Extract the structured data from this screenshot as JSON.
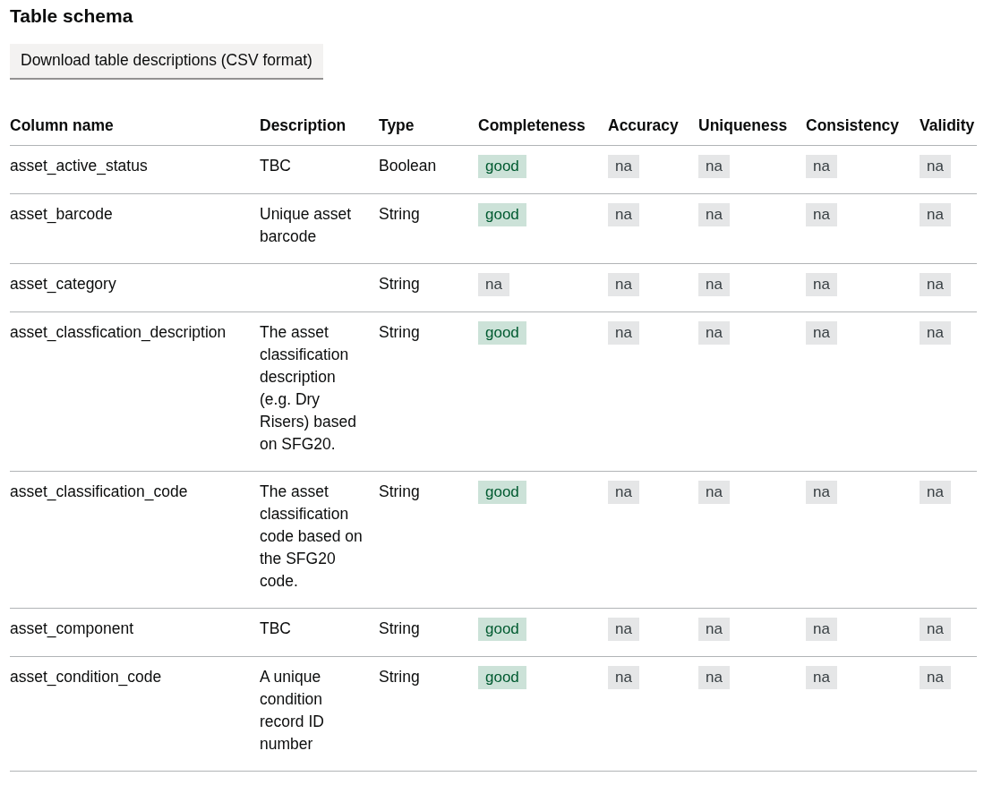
{
  "title": "Table schema",
  "download_button": "Download table descriptions (CSV format)",
  "table": {
    "columns": [
      "Column name",
      "Description",
      "Type",
      "Completeness",
      "Accuracy",
      "Uniqueness",
      "Consistency",
      "Validity"
    ],
    "rows": [
      {
        "name": "asset_active_status",
        "description": "TBC",
        "type": "Boolean",
        "tags": [
          {
            "label": "good",
            "kind": "positive"
          },
          {
            "label": "na",
            "kind": "neutral"
          },
          {
            "label": "na",
            "kind": "neutral"
          },
          {
            "label": "na",
            "kind": "neutral"
          },
          {
            "label": "na",
            "kind": "neutral"
          }
        ]
      },
      {
        "name": "asset_barcode",
        "description": "Unique asset barcode",
        "type": "String",
        "tags": [
          {
            "label": "good",
            "kind": "positive"
          },
          {
            "label": "na",
            "kind": "neutral"
          },
          {
            "label": "na",
            "kind": "neutral"
          },
          {
            "label": "na",
            "kind": "neutral"
          },
          {
            "label": "na",
            "kind": "neutral"
          }
        ]
      },
      {
        "name": "asset_category",
        "type": "String",
        "tags": [
          {
            "label": "na",
            "kind": "neutral"
          },
          {
            "label": "na",
            "kind": "neutral"
          },
          {
            "label": "na",
            "kind": "neutral"
          },
          {
            "label": "na",
            "kind": "neutral"
          },
          {
            "label": "na",
            "kind": "neutral"
          }
        ]
      },
      {
        "name": "asset_classfication_description",
        "description": "The asset classification description (e.g. Dry Risers) based on SFG20.",
        "type": "String",
        "tags": [
          {
            "label": "good",
            "kind": "positive"
          },
          {
            "label": "na",
            "kind": "neutral"
          },
          {
            "label": "na",
            "kind": "neutral"
          },
          {
            "label": "na",
            "kind": "neutral"
          },
          {
            "label": "na",
            "kind": "neutral"
          }
        ]
      },
      {
        "name": "asset_classification_code",
        "description": "The asset classification code based on the SFG20 code.",
        "type": "String",
        "tags": [
          {
            "label": "good",
            "kind": "positive"
          },
          {
            "label": "na",
            "kind": "neutral"
          },
          {
            "label": "na",
            "kind": "neutral"
          },
          {
            "label": "na",
            "kind": "neutral"
          },
          {
            "label": "na",
            "kind": "neutral"
          }
        ]
      },
      {
        "name": "asset_component",
        "description": "TBC",
        "type": "String",
        "tags": [
          {
            "label": "good",
            "kind": "positive"
          },
          {
            "label": "na",
            "kind": "neutral"
          },
          {
            "label": "na",
            "kind": "neutral"
          },
          {
            "label": "na",
            "kind": "neutral"
          },
          {
            "label": "na",
            "kind": "neutral"
          }
        ]
      },
      {
        "name": "asset_condition_code",
        "description": "A unique condition record ID number",
        "type": "String",
        "tags": [
          {
            "label": "good",
            "kind": "positive"
          },
          {
            "label": "na",
            "kind": "neutral"
          },
          {
            "label": "na",
            "kind": "neutral"
          },
          {
            "label": "na",
            "kind": "neutral"
          },
          {
            "label": "na",
            "kind": "neutral"
          }
        ]
      }
    ]
  }
}
